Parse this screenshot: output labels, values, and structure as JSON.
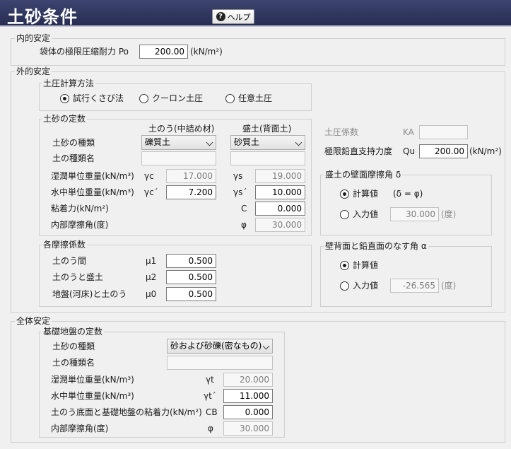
{
  "header": {
    "title": "土砂条件",
    "help_label": "ヘルプ",
    "help_icon": "?"
  },
  "internal": {
    "legend": "内的安定",
    "bag_strength": {
      "label": "袋体の極限圧縮耐力 Po",
      "value": "200.00",
      "unit": "(kN/m²)"
    }
  },
  "external": {
    "legend": "外的安定",
    "earth_pressure_method": {
      "legend": "土圧計算方法",
      "options": [
        "試行くさび法",
        "クーロン土圧",
        "任意土圧"
      ],
      "selected": 0
    },
    "soil_constants": {
      "legend": "土砂の定数",
      "col_bag": "土のう(中詰め材)",
      "col_fill": "盛土(背面土)",
      "soil_type_label": "土砂の種類",
      "soil_name_label": "土の種類名",
      "bag_soil_type": "礫質土",
      "fill_soil_type": "砂質土",
      "wet_weight": {
        "label": "湿潤単位重量(kN/m³)",
        "sym_bag": "γc",
        "bag_value": "17.000",
        "sym_fill": "γs",
        "fill_value": "19.000"
      },
      "sub_weight": {
        "label": "水中単位重量(kN/m³)",
        "sym_bag": "γc´",
        "bag_value": "7.200",
        "sym_fill": "γs´",
        "fill_value": "10.000"
      },
      "cohesion": {
        "label": "粘着力(kN/m²)",
        "sym": "C",
        "value": "0.000"
      },
      "friction_angle": {
        "label": "内部摩擦角(度)",
        "sym": "φ",
        "value": "30.000"
      }
    },
    "friction_coefs": {
      "legend": "各摩擦係数",
      "rows": [
        {
          "label": "土のう間",
          "sym": "μ1",
          "value": "0.500"
        },
        {
          "label": "土のうと盛土",
          "sym": "μ2",
          "value": "0.500"
        },
        {
          "label": "地盤(河床)と土のう",
          "sym": "μ0",
          "value": "0.500"
        }
      ]
    },
    "earth_pressure_coef": {
      "label": "土圧係数",
      "sym": "KA",
      "value": ""
    },
    "bearing_capacity": {
      "label": "極限鉛直支持力度",
      "sym": "Qu",
      "value": "200.00",
      "unit": "(kN/m²)"
    },
    "wall_friction": {
      "legend": "盛土の壁面摩擦角 δ",
      "calc_label": "計算値",
      "calc_note": "(δ = φ)",
      "input_label": "入力値",
      "input_value": "30.000",
      "unit": "(度)",
      "selected": 0
    },
    "wall_angle": {
      "legend": "壁背面と鉛直面のなす角 α",
      "calc_label": "計算値",
      "input_label": "入力値",
      "input_value": "-26.565",
      "unit": "(度)",
      "selected": 0
    }
  },
  "overall": {
    "legend": "全体安定",
    "foundation": {
      "legend": "基礎地盤の定数",
      "soil_type_label": "土砂の種類",
      "soil_type_value": "砂および砂礫(密なもの)",
      "soil_name_label": "土の種類名",
      "soil_name_value": "",
      "rows": [
        {
          "label": "湿潤単位重量(kN/m³)",
          "sym": "γt",
          "value": "20.000",
          "readonly": true
        },
        {
          "label": "水中単位重量(kN/m³)",
          "sym": "γt´",
          "value": "11.000",
          "readonly": false
        },
        {
          "label": "土のう底面と基礎地盤の粘着力(kN/m²)",
          "sym": "CB",
          "value": "0.000",
          "readonly": false
        },
        {
          "label": "内部摩擦角(度)",
          "sym": "φ",
          "value": "30.000",
          "readonly": true
        }
      ]
    }
  }
}
